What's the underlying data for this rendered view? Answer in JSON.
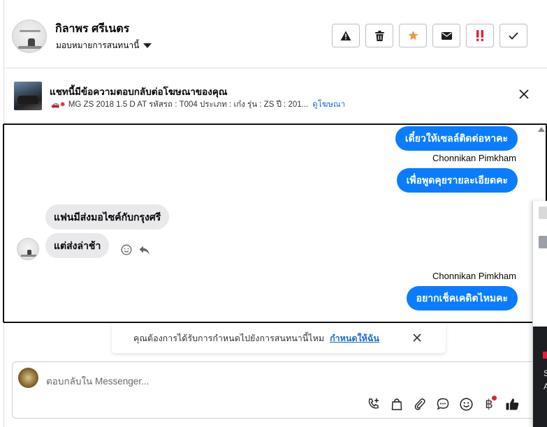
{
  "header": {
    "customer_name": "กิลาพร ศรีเนตร",
    "assign_label": "มอบหมายการสนทนานี้",
    "toolbar": [
      {
        "name": "report-spam-button",
        "icon": "warning-icon"
      },
      {
        "name": "delete-button",
        "icon": "trash-icon"
      },
      {
        "name": "star-button",
        "icon": "star-icon"
      },
      {
        "name": "mark-unread-button",
        "icon": "mail-icon"
      },
      {
        "name": "follow-up-button",
        "icon": "double-exclamation-icon"
      },
      {
        "name": "mark-done-button",
        "icon": "checkmark-icon"
      }
    ],
    "colors": {
      "star": "#f7923a",
      "follow_up": "#e41e3f"
    }
  },
  "ad": {
    "title": "แชทนี้มีข้อความตอบกลับต่อโฆษณาของคุณ",
    "details": "MG ZS 2018 1.5 D AT รหัสรถ : T004 ประเภท : เก๋ง รุ่น : ZS ปี : 201...",
    "link": "ดูโฆษณา"
  },
  "messages": [
    {
      "direction": "out",
      "text": "เดี๋ยวให้เซลล์ติดต่อหาคะ"
    },
    {
      "direction": "sender",
      "text": "Chonnikan Pimkham"
    },
    {
      "direction": "out",
      "text": "เพื่อพูดคุยรายละเอียดคะ"
    },
    {
      "direction": "in",
      "text": "แฟนมีส่งมอไซค์กับกรุงศรี"
    },
    {
      "direction": "in",
      "text": "แต่ส่งล่าช้า"
    },
    {
      "direction": "sender",
      "text": "Chonnikan Pimkham"
    },
    {
      "direction": "out",
      "text": "อยากเช็คเคดิตไหมคะ"
    }
  ],
  "toast": {
    "text": "คุณต้องการได้รับการกำหนดไปยังการสนทนานี้ไหม",
    "link": "กำหนดให้ฉัน"
  },
  "composer": {
    "placeholder": "ตอบกลับใน Messenger...",
    "tools": [
      "call-add-icon",
      "shopping-bag-icon",
      "paperclip-icon",
      "saved-reply-icon",
      "emoji-icon",
      "baht-payment-icon",
      "thumbs-up-icon"
    ],
    "baht_symbol": "฿"
  },
  "side_panel": {
    "line1": "S",
    "line2": "A"
  },
  "colors": {
    "accent": "#0a7cff",
    "link": "#1a6bd1",
    "incoming_bubble": "#e9e9eb"
  }
}
